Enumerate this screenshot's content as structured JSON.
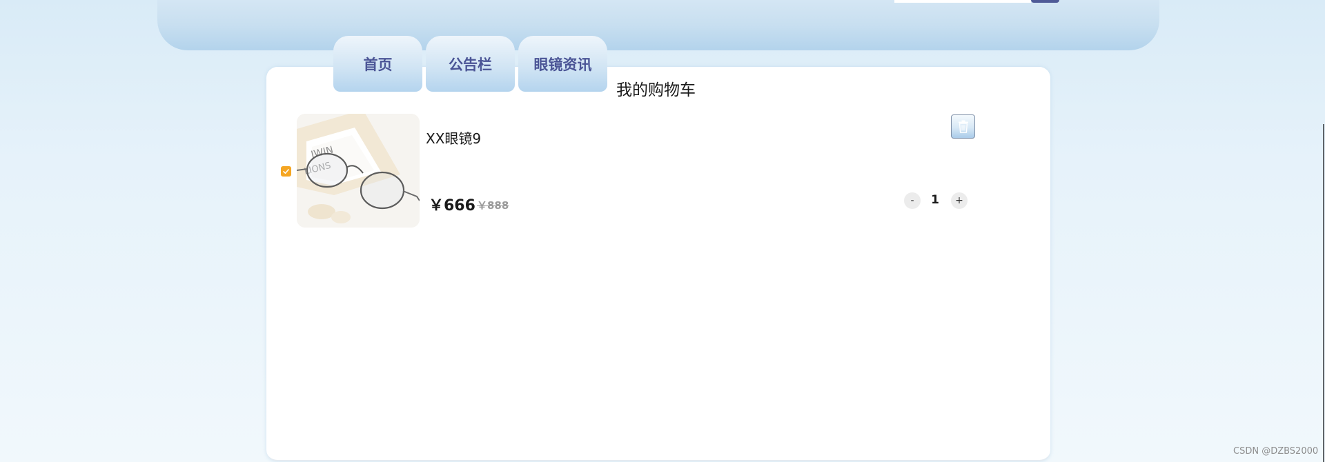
{
  "header": {
    "search": {
      "value": "",
      "placeholder": ""
    },
    "search_button_icon": "search-submit"
  },
  "nav": {
    "tabs": [
      {
        "label": "首页"
      },
      {
        "label": "公告栏"
      },
      {
        "label": "眼镜资讯"
      }
    ]
  },
  "page": {
    "title": "我的购物车"
  },
  "cart": {
    "items": [
      {
        "checked": true,
        "name": "XX眼镜9",
        "price": "￥666",
        "original_price": "￥888",
        "quantity": "1",
        "minus_label": "-",
        "plus_label": "+",
        "delete_icon": "trash-icon",
        "image_icon": "glasses-photo"
      }
    ]
  },
  "watermark": "CSDN @DZBS2000",
  "colors": {
    "accent": "#4f5a97",
    "checkbox": "#f5a623",
    "nav_text": "#4b5596"
  }
}
